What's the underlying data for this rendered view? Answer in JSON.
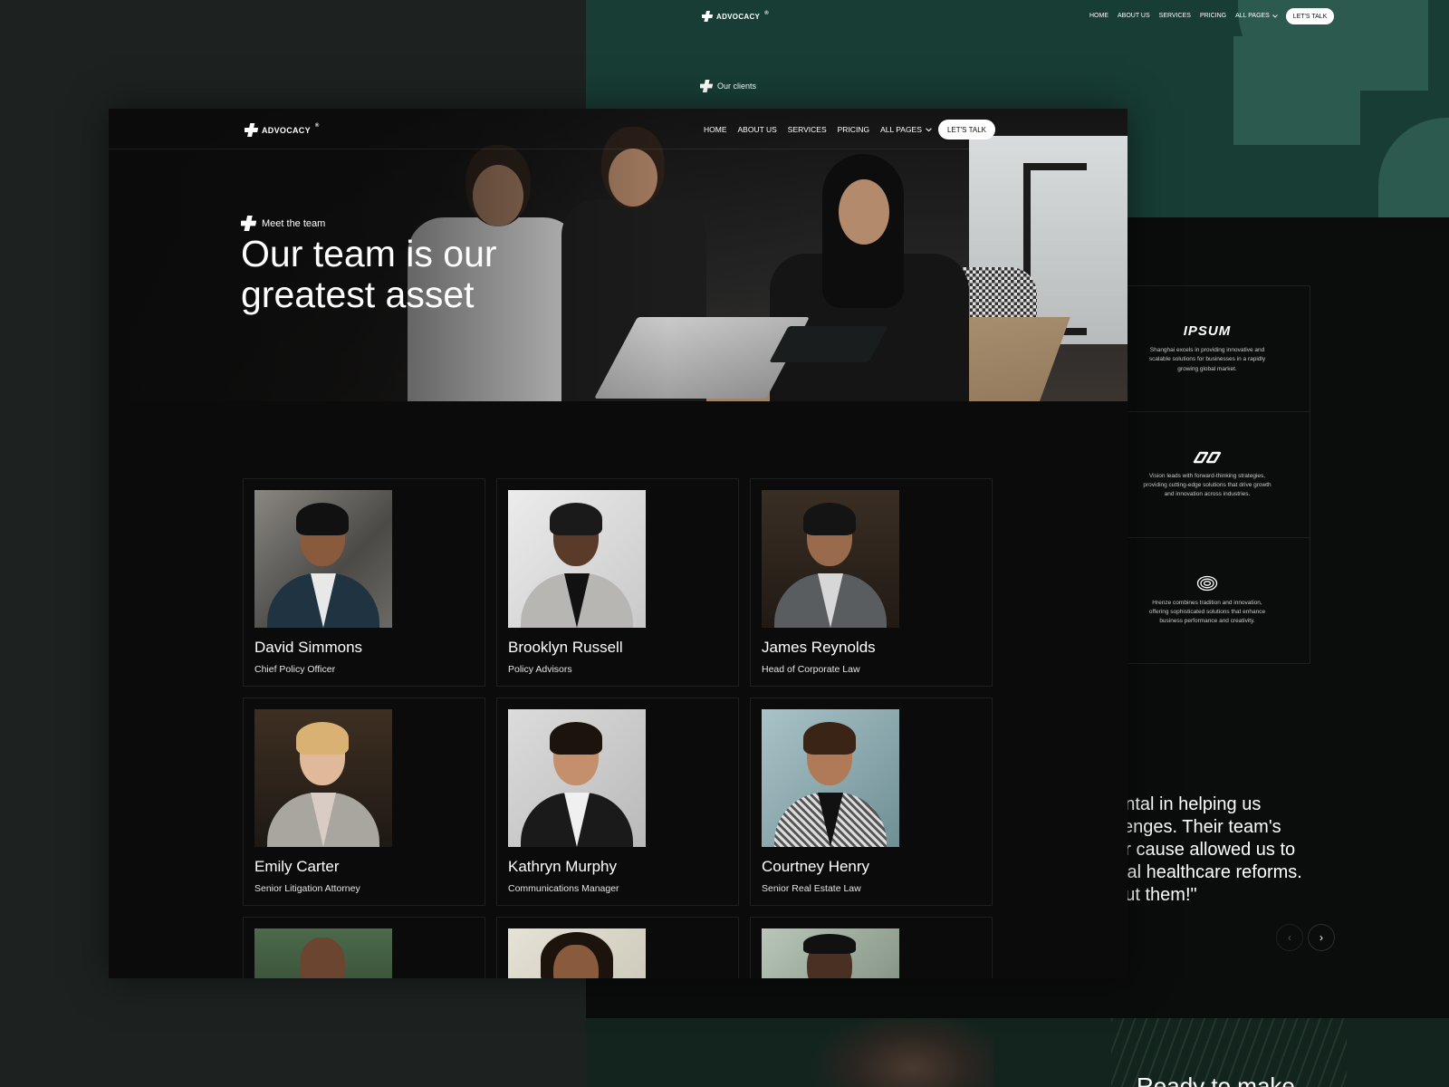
{
  "brand": {
    "name": "ADVOCACY",
    "mark": "®"
  },
  "back_window": {
    "nav": {
      "links": [
        "HOME",
        "ABOUT US",
        "SERVICES",
        "PRICING",
        "ALL PAGES"
      ],
      "cta": "LET'S TALK"
    },
    "eyebrow": "Our clients",
    "clients": [
      {
        "logo": "IPSUM",
        "description": "Shanghai excels in providing innovative and scalable solutions for businesses in a rapidly growing global market."
      },
      {
        "logo": "infinity-logo",
        "description": "Vision leads with forward-thinking strategies, providing cutting-edge solutions that drive growth and innovation across industries."
      },
      {
        "logo": "spiral-logo",
        "description": "Hrenze combines tradition and innovation, offering sophisticated solutions that enhance business performance and creativity."
      }
    ],
    "quote_lines": [
      "nental in helping us",
      "allenges. Their team's",
      "our cause allowed us to",
      "itical healthcare reforms.",
      "hout them!\""
    ],
    "carousel": {
      "prev": "‹",
      "next": "›"
    },
    "cta_heading": "Ready to make"
  },
  "front_window": {
    "nav": {
      "links": [
        "HOME",
        "ABOUT US",
        "SERVICES",
        "PRICING",
        "ALL PAGES"
      ],
      "cta": "LET'S TALK"
    },
    "eyebrow": "Meet the team",
    "title": "Our team is our greatest asset",
    "team": [
      {
        "name": "David Simmons",
        "role": "Chief Policy Officer"
      },
      {
        "name": "Brooklyn Russell",
        "role": "Policy Advisors"
      },
      {
        "name": "James Reynolds",
        "role": "Head of Corporate Law"
      },
      {
        "name": "Emily Carter",
        "role": "Senior Litigation Attorney"
      },
      {
        "name": "Kathryn Murphy",
        "role": "Communications Manager"
      },
      {
        "name": "Courtney Henry",
        "role": "Senior Real Estate Law"
      },
      {
        "name": "",
        "role": ""
      },
      {
        "name": "",
        "role": ""
      },
      {
        "name": "",
        "role": ""
      }
    ]
  },
  "colors": {
    "page_bg": "#1d2221",
    "hero_green": "#173d34",
    "deco_green": "#2c5a4e",
    "dark_bg": "#0b0b0b",
    "card_border": "#1e1f1f",
    "cta_bg": "#ffffff"
  },
  "icons": [
    "plus-logo-icon",
    "chevron-down-icon",
    "chevron-left-icon",
    "chevron-right-icon"
  ]
}
